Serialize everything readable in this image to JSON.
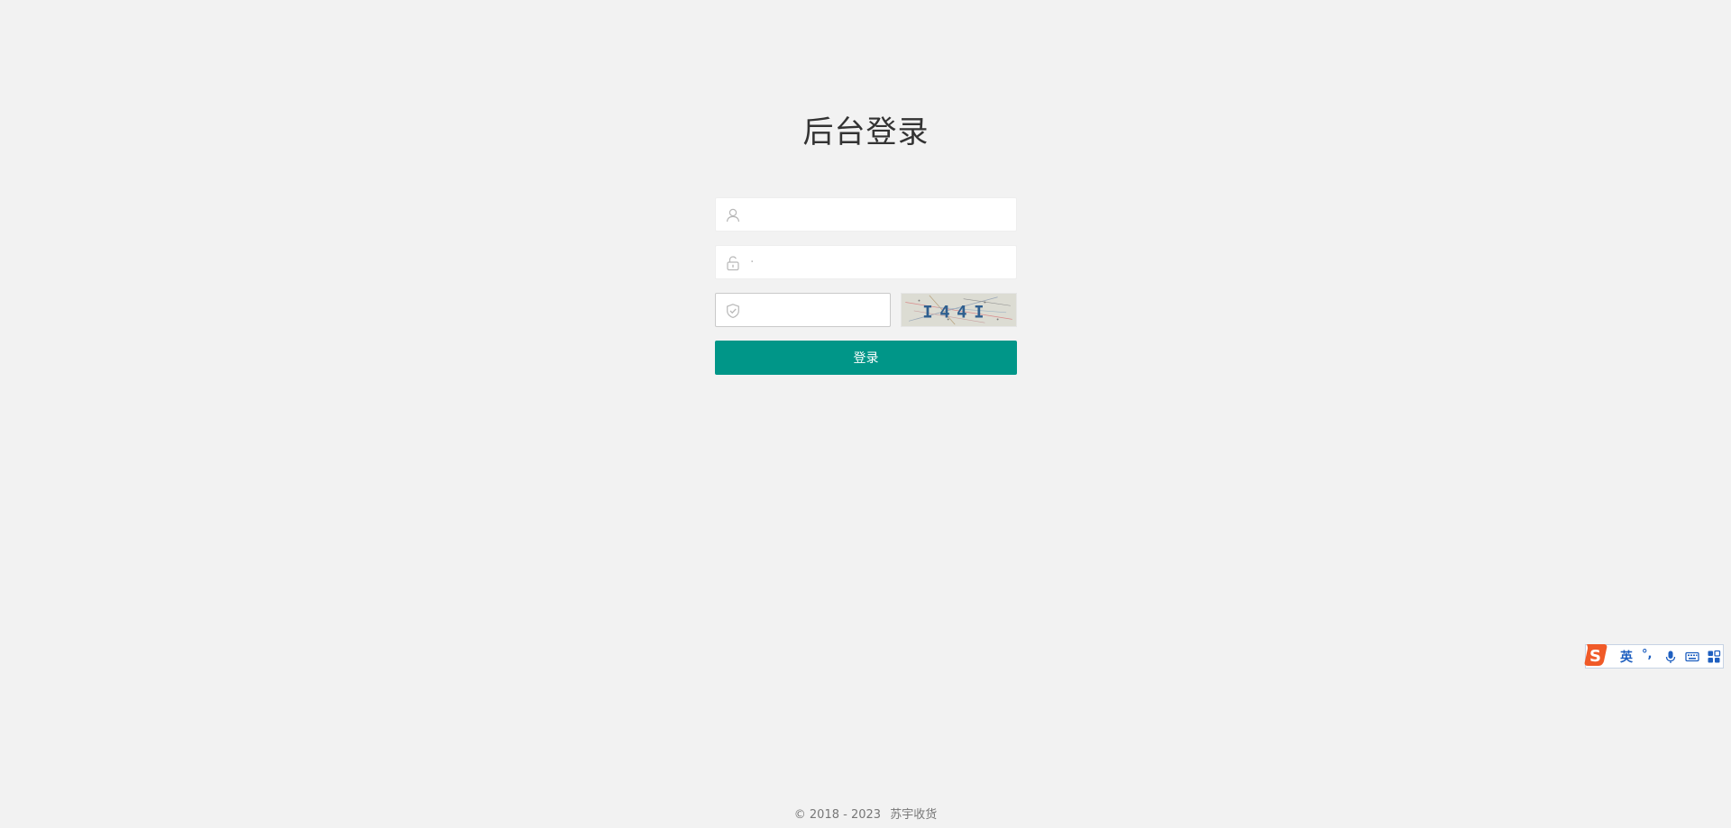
{
  "login": {
    "title": "后台登录",
    "username": {
      "value": "",
      "placeholder": ""
    },
    "password": {
      "value": "",
      "placeholder": "·"
    },
    "captcha": {
      "value": "",
      "placeholder": ""
    },
    "captcha_image_text": "I44I",
    "submit_label": "登录"
  },
  "footer": {
    "copyright": "© 2018 - 2023",
    "company": "苏宇收货"
  },
  "ime": {
    "lang_label": "英",
    "punct_label": "°,"
  },
  "colors": {
    "background": "#f2f2f2",
    "primary": "#009688",
    "ime_blue": "#1e5fc0",
    "ime_logo": "#f05a28"
  },
  "icons": [
    "user-icon",
    "unlock-icon",
    "shield-check-icon",
    "sogou-logo-icon",
    "microphone-icon",
    "keyboard-icon",
    "grid-apps-icon"
  ]
}
